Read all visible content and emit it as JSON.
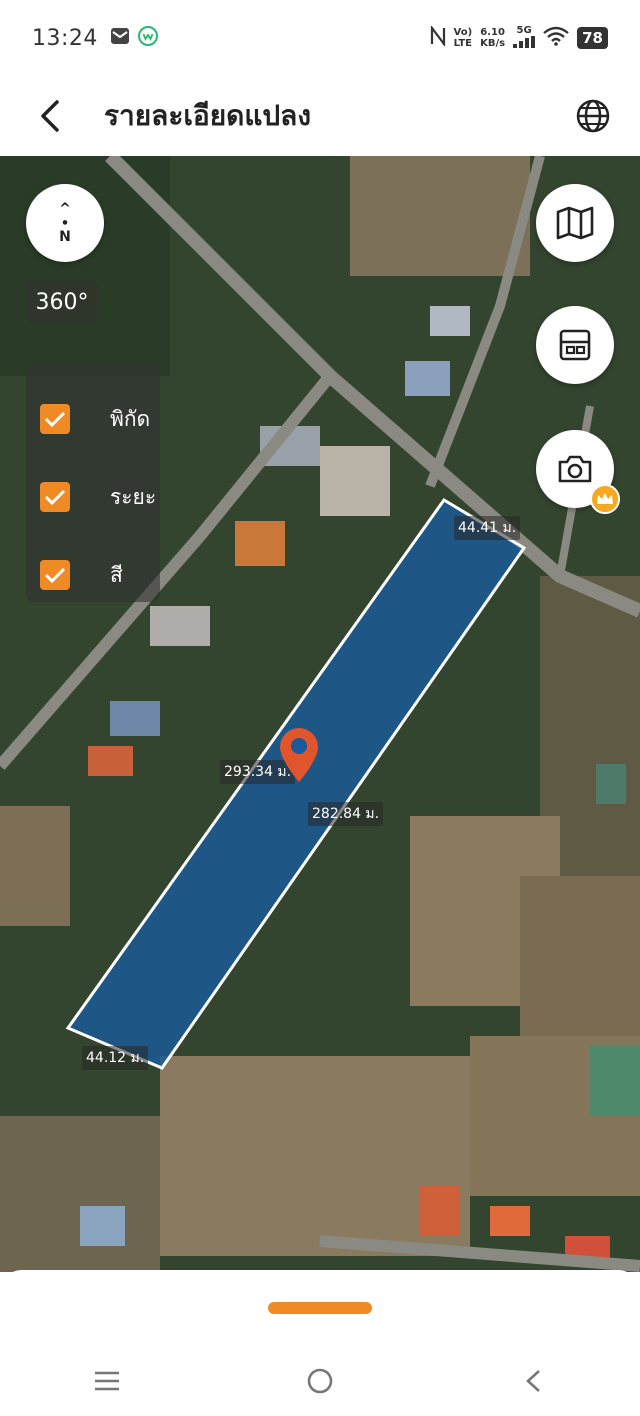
{
  "status_bar": {
    "time": "13:24",
    "network_top": "Vo)",
    "network_bottom": "LTE",
    "speed_top": "6.10",
    "speed_bottom": "KB/s",
    "signal_label": "5G",
    "battery": "78"
  },
  "header": {
    "title": "รายละเอียดแปลง"
  },
  "map": {
    "compass_arrow": "^",
    "compass_letter": "N",
    "rotation": "360°",
    "layers": [
      {
        "label": "พิกัด",
        "checked": true
      },
      {
        "label": "ระยะ",
        "checked": true
      },
      {
        "label": "สี",
        "checked": true
      }
    ],
    "dimensions": {
      "top": "44.41 ม.",
      "left": "293.34 ม.",
      "right": "282.84 ม.",
      "bottom": "44.12 ม."
    },
    "parcel_color": "#1a5a9a",
    "marker_color": "#e0552b",
    "accent_color": "#f08a24"
  }
}
